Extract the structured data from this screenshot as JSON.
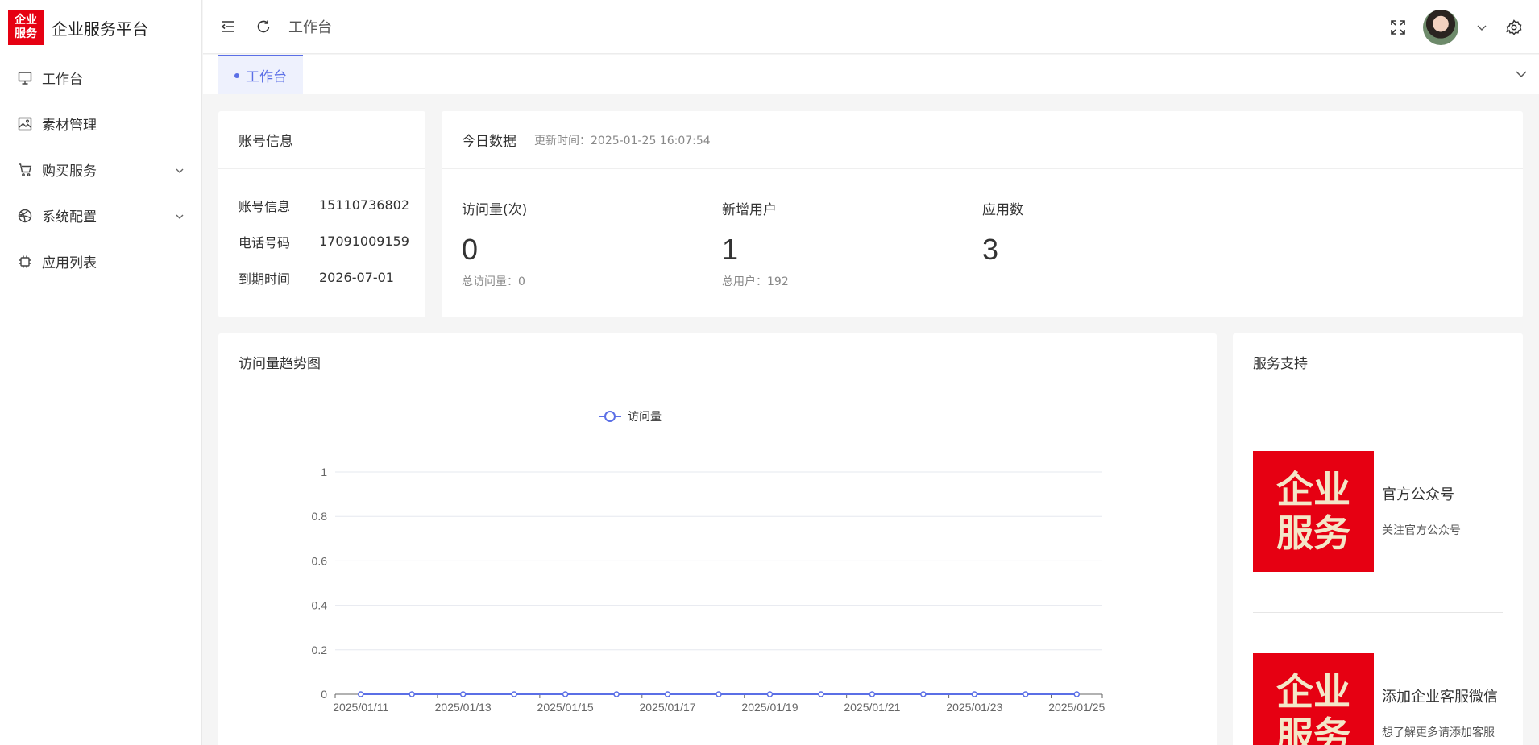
{
  "app": {
    "logo_text": [
      "企业",
      "服务"
    ],
    "title": "企业服务平台"
  },
  "sidebar": {
    "items": [
      {
        "label": "工作台",
        "icon": "monitor-icon",
        "has_arrow": false
      },
      {
        "label": "素材管理",
        "icon": "image-icon",
        "has_arrow": false
      },
      {
        "label": "购买服务",
        "icon": "cart-icon",
        "has_arrow": true
      },
      {
        "label": "系统配置",
        "icon": "dribbble-icon",
        "has_arrow": true
      },
      {
        "label": "应用列表",
        "icon": "chip-icon",
        "has_arrow": false
      }
    ]
  },
  "header": {
    "breadcrumb": "工作台"
  },
  "tabs": {
    "active": "工作台"
  },
  "account": {
    "title": "账号信息",
    "rows": [
      {
        "label": "账号信息",
        "value": "15110736802"
      },
      {
        "label": "电话号码",
        "value": "17091009159"
      },
      {
        "label": "到期时间",
        "value": "2026-07-01"
      }
    ]
  },
  "today": {
    "title": "今日数据",
    "updated": "更新时间：2025-01-25 16:07:54",
    "stats": [
      {
        "label": "访问量(次)",
        "value": "0",
        "total": "总访问量：0"
      },
      {
        "label": "新增用户",
        "value": "1",
        "total": "总用户：192"
      },
      {
        "label": "应用数",
        "value": "3",
        "total": ""
      }
    ]
  },
  "trend": {
    "title": "访问量趋势图"
  },
  "support": {
    "title": "服务支持",
    "items": [
      {
        "title": "官方公众号",
        "desc": "关注官方公众号",
        "logo": [
          "企业",
          "服务"
        ]
      },
      {
        "title": "添加企业客服微信",
        "desc": "想了解更多请添加客服",
        "logo": [
          "企业",
          "服务"
        ]
      }
    ]
  },
  "colors": {
    "brand": "#e60012",
    "accent": "#5b6fe6"
  },
  "chart_data": {
    "type": "line",
    "legend": "访问量",
    "legend_position": "top-center",
    "x": [
      "2025/01/11",
      "2025/01/12",
      "2025/01/13",
      "2025/01/14",
      "2025/01/15",
      "2025/01/16",
      "2025/01/17",
      "2025/01/18",
      "2025/01/19",
      "2025/01/20",
      "2025/01/21",
      "2025/01/22",
      "2025/01/23",
      "2025/01/24",
      "2025/01/25"
    ],
    "x_tick_labels": [
      "2025/01/11",
      "2025/01/13",
      "2025/01/15",
      "2025/01/17",
      "2025/01/19",
      "2025/01/21",
      "2025/01/23",
      "2025/01/25"
    ],
    "series": [
      {
        "name": "访问量",
        "values": [
          0,
          0,
          0,
          0,
          0,
          0,
          0,
          0,
          0,
          0,
          0,
          0,
          0,
          0,
          0
        ]
      }
    ],
    "y_ticks": [
      "0",
      "0.2",
      "0.4",
      "0.6",
      "0.8",
      "1"
    ],
    "ylim": [
      0,
      1
    ],
    "grid": true
  }
}
